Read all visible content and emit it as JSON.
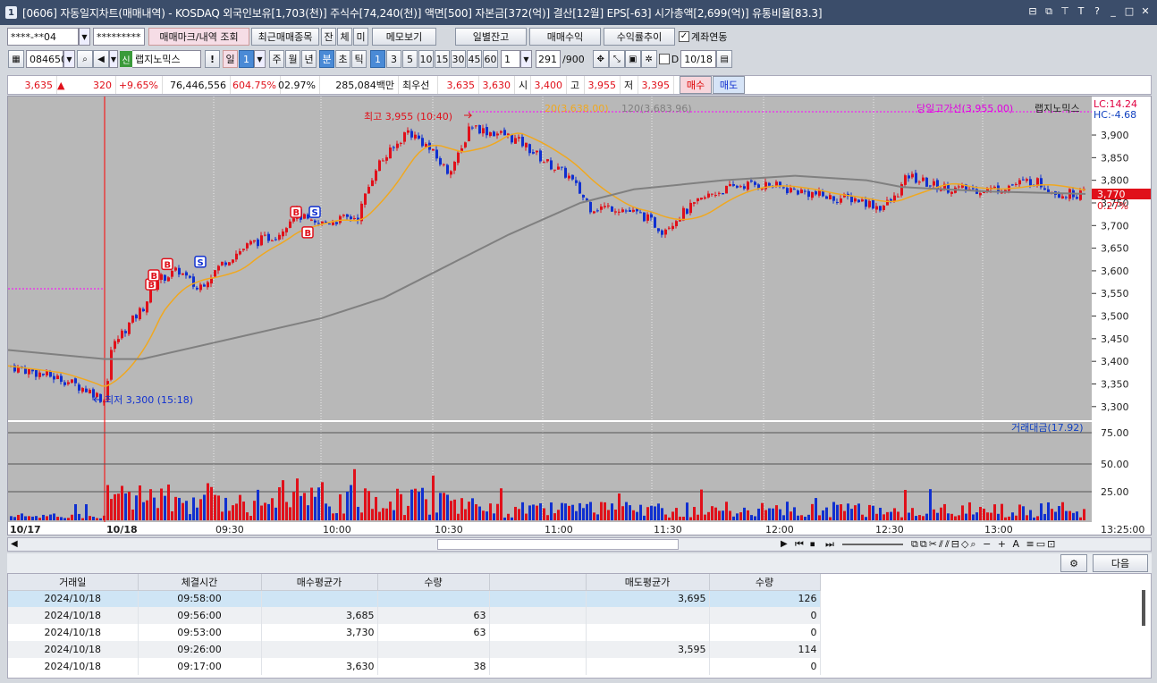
{
  "window": {
    "icon": "1",
    "title": "[0606] 자동일지차트(매매내역) - KOSDAQ 외국인보유[1,703(천)] 주식수[74,240(천)] 액면[500] 자본금[372(억)] 결산[12월] EPS[-63] 시가총액[2,699(억)] 유통비율[83.3]",
    "controls": [
      "⊟",
      "⧉",
      "T",
      "T",
      "?",
      "_",
      "□",
      "✕"
    ]
  },
  "toolbar1": {
    "account": "****-**04",
    "password": "*********",
    "btn_mark": "매매마크/내역 조회",
    "btn_recent": "최근매매종목",
    "btn_jan": "잔",
    "btn_che": "체",
    "btn_mi": "미",
    "btn_memo": "메모보기",
    "btn_daily": "일별잔고",
    "btn_profit": "매매수익",
    "btn_rate": "수익률추이",
    "chk_link_label": "계좌연동",
    "chk_link": true
  },
  "toolbar2": {
    "code": "084650",
    "badge_new": "신",
    "stock_name": "랩지노믹스",
    "excl": "!",
    "period_day": "일",
    "period_num": "1",
    "periods": [
      "주",
      "월",
      "년"
    ],
    "period_min": "분",
    "periods2": [
      "초",
      "틱"
    ],
    "intervals": [
      "1",
      "3",
      "5",
      "10",
      "15",
      "30",
      "45",
      "60"
    ],
    "interval_sel": "1",
    "count": "1",
    "bars": "291",
    "bars_total": "/900",
    "chk_d": "D",
    "date": "10/18"
  },
  "quote": {
    "price": "3,635",
    "arrow": "▲",
    "change": "320",
    "change_pct": "+9.65%",
    "volume": "76,446,556",
    "vol_ratio": "604.75%",
    "turnover": "02.97%",
    "amount": "285,084백만",
    "bid_label": "최우선",
    "ask1": "3,635",
    "bid1": "3,630",
    "open_label": "시",
    "open": "3,400",
    "high_label": "고",
    "high": "3,955",
    "low_label": "저",
    "low": "3,395",
    "buy_btn": "매수",
    "sell_btn": "매도"
  },
  "chart": {
    "legend_ma20": "20(3,638.00)",
    "legend_ma120": "120(3,683.96)",
    "legend_high_line": "당일고가선(3,955.00)",
    "legend_name": "랩지노믹스",
    "lc": "LC:14.24",
    "hc": "HC:-4.68",
    "high_label": "최고 3,955 (10:40)",
    "low_label": "최저 3,300 (15:18)",
    "cur_price": "3,770",
    "cur_pct": "0.27%",
    "vol_legend": "거래대금(17.92)",
    "time_label": "13:25:00",
    "colors": {
      "up": "#e0101a",
      "down": "#1030d0",
      "ma20": "#f0a820",
      "ma120": "#808080",
      "marker": "#ff00ff"
    }
  },
  "chart_data": {
    "type": "candlestick",
    "y_ticks": [
      "3,900",
      "3,850",
      "3,800",
      "3,750",
      "3,700",
      "3,650",
      "3,600",
      "3,550",
      "3,500",
      "3,450",
      "3,400",
      "3,350",
      "3,300"
    ],
    "ylim": [
      3270,
      3985
    ],
    "vol_ticks": [
      "75.00",
      "50.00",
      "25.00"
    ],
    "x_labels": [
      "10/17",
      "10/18",
      "09:30",
      "10:00",
      "10:30",
      "11:00",
      "11:30",
      "12:00",
      "12:30",
      "13:00"
    ],
    "trade_marks": [
      {
        "type": "B",
        "price": 3570
      },
      {
        "type": "B",
        "price": 3590
      },
      {
        "type": "B",
        "price": 3615
      },
      {
        "type": "S",
        "price": 3620
      },
      {
        "type": "B",
        "price": 3730
      },
      {
        "type": "S",
        "price": 3730
      },
      {
        "type": "B",
        "price": 3685
      }
    ]
  },
  "bottom": {
    "settings_icon": "gear-icon",
    "next_btn": "다음",
    "columns": [
      "거래일",
      "체결시간",
      "매수평균가",
      "수량",
      "",
      "매도평균가",
      "수량"
    ],
    "rows": [
      [
        "2024/10/18",
        "09:58:00",
        "",
        "",
        "",
        "3,695",
        "126"
      ],
      [
        "2024/10/18",
        "09:56:00",
        "3,685",
        "63",
        "",
        "",
        "0"
      ],
      [
        "2024/10/18",
        "09:53:00",
        "3,730",
        "63",
        "",
        "",
        "0"
      ],
      [
        "2024/10/18",
        "09:26:00",
        "",
        "",
        "",
        "3,595",
        "114"
      ],
      [
        "2024/10/18",
        "09:17:00",
        "3,630",
        "38",
        "",
        "",
        "0"
      ]
    ]
  }
}
